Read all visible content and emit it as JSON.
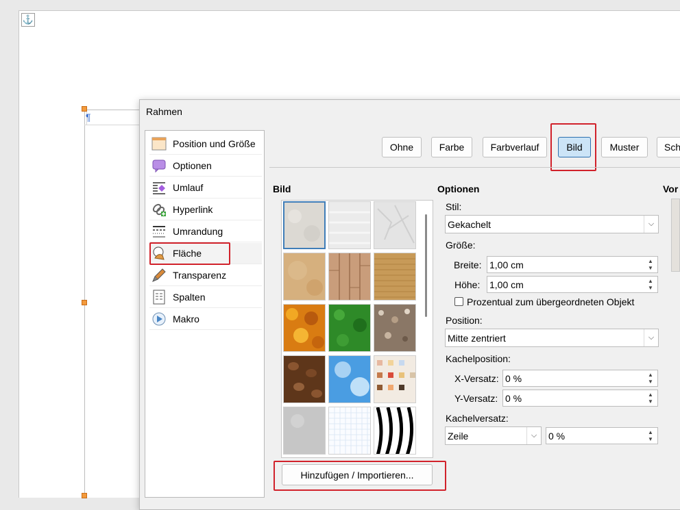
{
  "document": {
    "anchor_icon": "anchor-icon",
    "pilcrow": "¶"
  },
  "dialog": {
    "title": "Rahmen",
    "sidebar": [
      {
        "label": "Position und Größe",
        "icon": "position-size-icon"
      },
      {
        "label": "Optionen",
        "icon": "options-icon"
      },
      {
        "label": "Umlauf",
        "icon": "wrap-icon"
      },
      {
        "label": "Hyperlink",
        "icon": "hyperlink-icon"
      },
      {
        "label": "Umrandung",
        "icon": "border-icon"
      },
      {
        "label": "Fläche",
        "icon": "area-icon",
        "selected": true
      },
      {
        "label": "Transparenz",
        "icon": "transparency-icon"
      },
      {
        "label": "Spalten",
        "icon": "columns-icon"
      },
      {
        "label": "Makro",
        "icon": "macro-icon"
      }
    ],
    "fill_buttons": [
      "Ohne",
      "Farbe",
      "Farbverlauf",
      "Bild",
      "Muster",
      "Sch"
    ],
    "selected_fill": "Bild",
    "bitmap_section": {
      "heading": "Bild",
      "tiles": [
        "painted-white",
        "paper-texture",
        "paper-crumpled",
        "parchment",
        "wood",
        "fabric",
        "maple-leaves",
        "lawn",
        "pebbles",
        "coffee",
        "sky",
        "color-squares",
        "concrete",
        "grid-paper",
        "zebra"
      ],
      "add_button": "Hinzufügen / Importieren..."
    },
    "options": {
      "heading": "Optionen",
      "style_label": "Stil:",
      "style_value": "Gekachelt",
      "size_label": "Größe:",
      "width_label": "Breite:",
      "width_value": "1,00 cm",
      "height_label": "Höhe:",
      "height_value": "1,00 cm",
      "relative_label": "Prozentual zum übergeordneten Objekt",
      "position_label": "Position:",
      "position_value": "Mitte zentriert",
      "tile_position_label": "Kachelposition:",
      "x_offset_label": "X-Versatz:",
      "x_offset_value": "0 %",
      "y_offset_label": "Y-Versatz:",
      "y_offset_value": "0 %",
      "tile_offset_label": "Kachelversatz:",
      "tile_offset_mode": "Zeile",
      "tile_offset_value": "0 %"
    },
    "preview_heading": "Vor",
    "colors": {
      "accent": "#2c6fae",
      "highlight_red": "#d1212a",
      "selected_button_bg": "#cce4f7"
    }
  }
}
